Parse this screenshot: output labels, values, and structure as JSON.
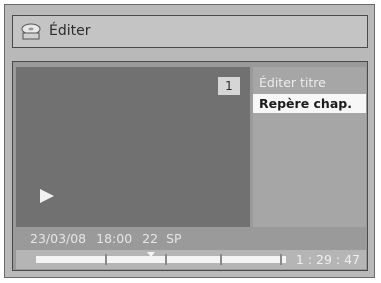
{
  "title_bar": {
    "icon": "disc-icon",
    "title": "Éditer"
  },
  "preview": {
    "chapter_number": "1",
    "play_icon": "play-icon"
  },
  "menu": {
    "items": [
      {
        "label": "Éditer titre",
        "selected": false
      },
      {
        "label": "Repère chap.",
        "selected": true
      }
    ]
  },
  "info": {
    "date": "23/03/08",
    "time": "18:00",
    "channel": "22",
    "mode": "SP"
  },
  "progress": {
    "elapsed": "1 : 29 : 47",
    "chapter_marks": [
      0.28,
      0.52,
      0.74,
      0.98
    ],
    "position": 0.46
  },
  "colors": {
    "background": "#b9b9b9",
    "panel": "#9a9a9a",
    "selected": "#f7f7f7"
  }
}
